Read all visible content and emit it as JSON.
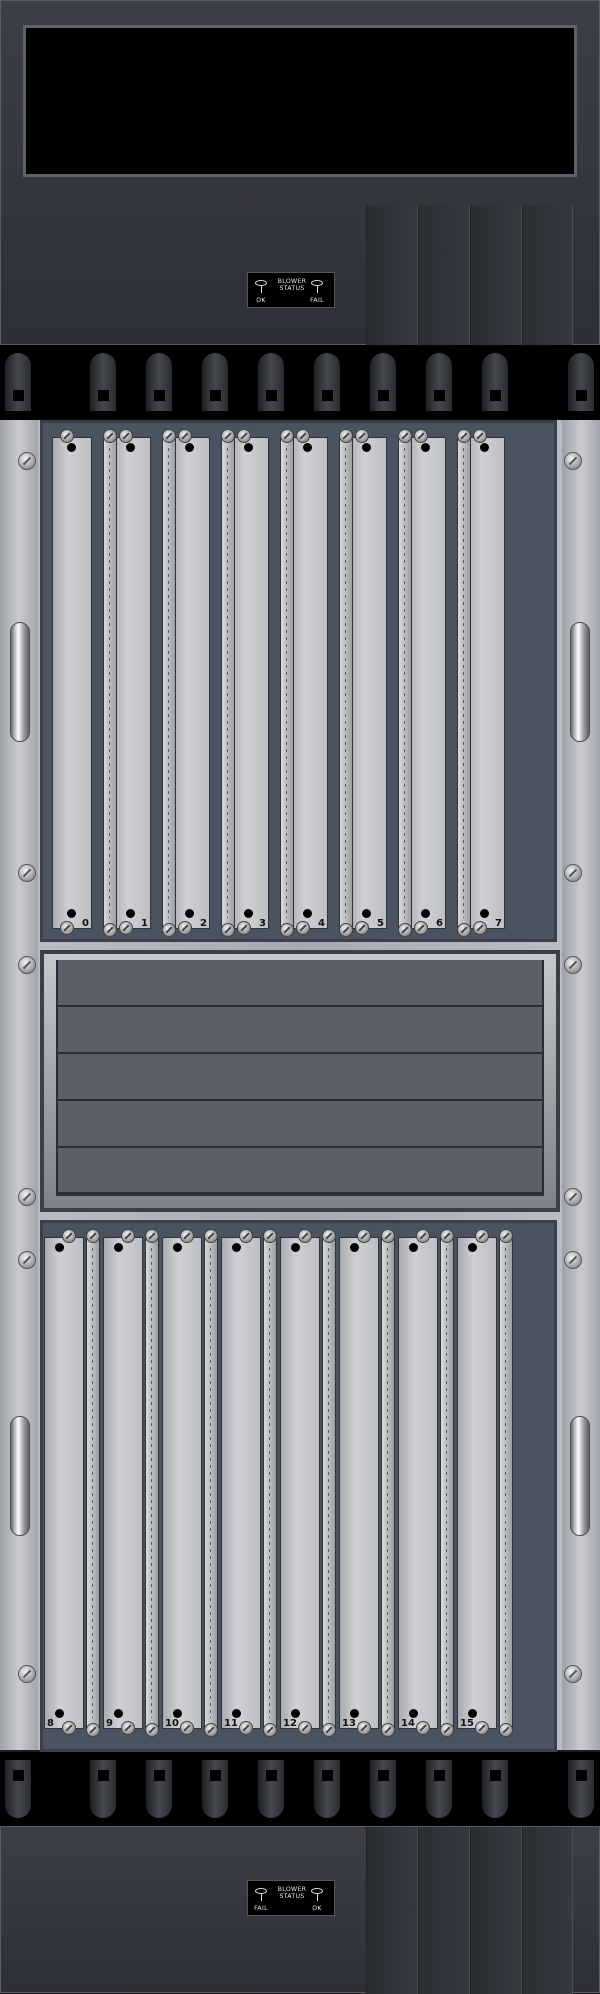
{
  "top_blower": {
    "status": {
      "title_line1": "BLOWER",
      "title_line2": "STATUS",
      "left_label": "OK",
      "right_label": "FAIL"
    }
  },
  "bottom_blower": {
    "status": {
      "title_line1": "BLOWER",
      "title_line2": "STATUS",
      "left_label": "FAIL",
      "right_label": "OK"
    }
  },
  "upper_cage": {
    "slots": [
      "0",
      "1",
      "2",
      "3",
      "4",
      "5",
      "6",
      "7"
    ]
  },
  "lower_cage": {
    "slots": [
      "8",
      "9",
      "10",
      "11",
      "12",
      "13",
      "14",
      "15"
    ]
  },
  "colors": {
    "chassis": "#a7aab2",
    "card": "#c4c5c8",
    "blower": "#31343a",
    "fan_tray": "#5b606a"
  }
}
